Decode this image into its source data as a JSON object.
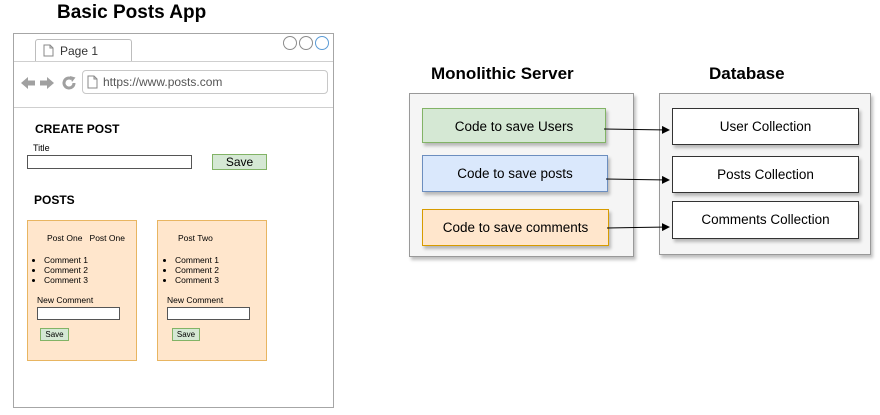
{
  "app_title": "Basic Posts App",
  "browser": {
    "tab_label": "Page 1",
    "url": "https://www.posts.com"
  },
  "create_post": {
    "heading": "CREATE POST",
    "title_label": "Title",
    "save_label": "Save"
  },
  "posts": {
    "heading": "POSTS",
    "cards": [
      {
        "title": "Post One   Post One",
        "comments": [
          "Comment 1",
          "Comment 2",
          "Comment 3"
        ],
        "new_comment_label": "New Comment",
        "save_label": "Save"
      },
      {
        "title": "Post Two",
        "comments": [
          "Comment 1",
          "Comment 2",
          "Comment 3"
        ],
        "new_comment_label": "New Comment",
        "save_label": "Save"
      }
    ]
  },
  "server": {
    "title": "Monolithic Server",
    "items": [
      {
        "label": "Code to save Users",
        "fill": "#d5e8d4",
        "stroke": "#82b366"
      },
      {
        "label": "Code to save posts",
        "fill": "#dae8fc",
        "stroke": "#6c8ebf"
      },
      {
        "label": "Code to save comments",
        "fill": "#ffe6cc",
        "stroke": "#d79b00"
      }
    ]
  },
  "database": {
    "title": "Database",
    "items": [
      "User Collection",
      "Posts Collection",
      "Comments Collection"
    ]
  }
}
